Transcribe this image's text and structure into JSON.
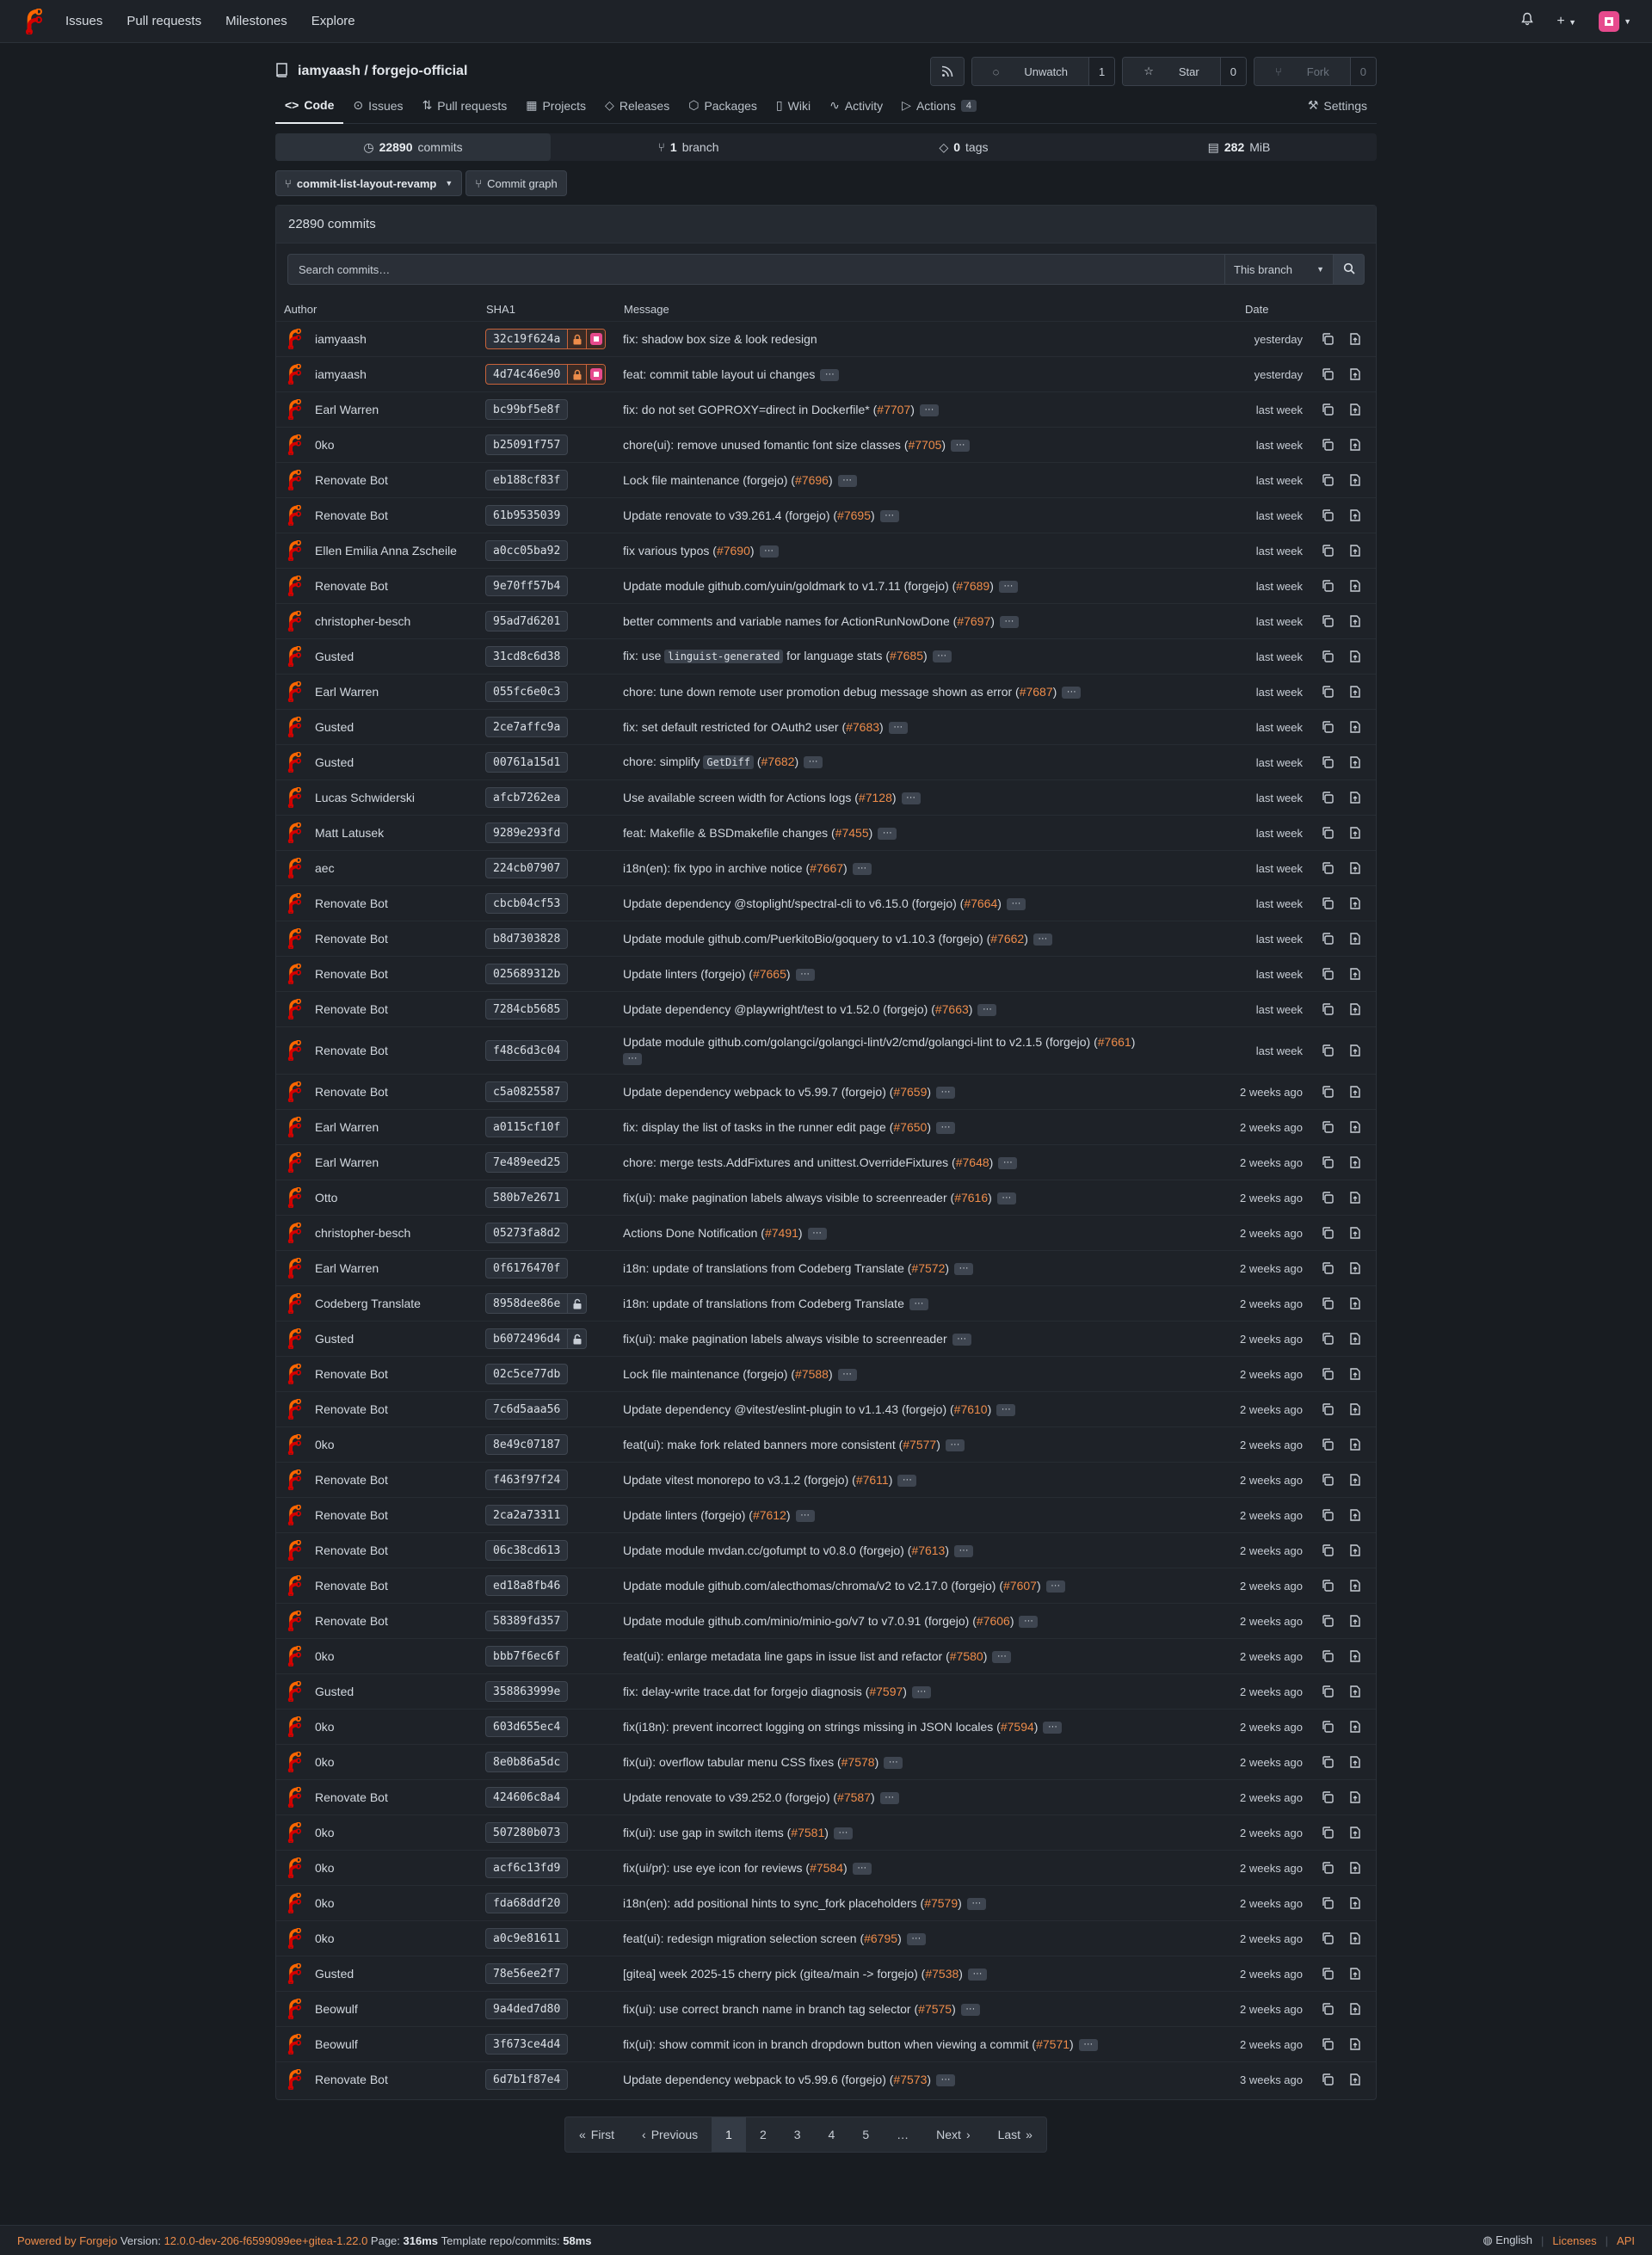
{
  "colors": {
    "accent": "#ee8c4a",
    "background": "#181c21",
    "surface": "#1e2228",
    "signed_border": "#c8633a"
  },
  "nav": {
    "links": [
      "Issues",
      "Pull requests",
      "Milestones",
      "Explore"
    ]
  },
  "repo": {
    "title": "iamyaash / forgejo-official",
    "unwatch_label": "Unwatch",
    "watch_count": "1",
    "star_label": "Star",
    "star_count": "0",
    "fork_label": "Fork",
    "fork_count": "0"
  },
  "tabs": [
    {
      "label": "Code",
      "icon": "code-icon"
    },
    {
      "label": "Issues",
      "icon": "issue-icon"
    },
    {
      "label": "Pull requests",
      "icon": "pull-request-icon"
    },
    {
      "label": "Projects",
      "icon": "project-icon"
    },
    {
      "label": "Releases",
      "icon": "tag-icon"
    },
    {
      "label": "Packages",
      "icon": "package-icon"
    },
    {
      "label": "Wiki",
      "icon": "book-icon"
    },
    {
      "label": "Activity",
      "icon": "pulse-icon"
    },
    {
      "label": "Actions",
      "icon": "play-icon",
      "badge": "4"
    },
    {
      "label": "Settings",
      "icon": "tool-icon"
    }
  ],
  "stats": {
    "commits_num": "22890",
    "commits_label": "commits",
    "branches_num": "1",
    "branches_label": "branch",
    "tags_num": "0",
    "tags_label": "tags",
    "size_num": "282",
    "size_unit": "MiB"
  },
  "branch": {
    "name": "commit-list-layout-revamp",
    "graph_label": "Commit graph"
  },
  "panel": {
    "title": "22890 commits",
    "search_placeholder": "Search commits…",
    "branch_filter": "This branch",
    "columns": {
      "author": "Author",
      "sha": "SHA1",
      "message": "Message",
      "date": "Date"
    }
  },
  "commits": [
    {
      "author": "iamyaash",
      "sha": "32c19f624a",
      "msg": "fix: shadow box size & look redesign",
      "pr": "",
      "date": "yesterday",
      "signed": true,
      "ell": false
    },
    {
      "author": "iamyaash",
      "sha": "4d74c46e90",
      "msg": "feat: commit table layout ui changes",
      "pr": "",
      "date": "yesterday",
      "signed": true,
      "ell": true
    },
    {
      "author": "Earl Warren",
      "sha": "bc99bf5e8f",
      "msg": "fix: do not set GOPROXY=direct in Dockerfile* (",
      "pr": "#7707",
      "date": "last week",
      "ell": true
    },
    {
      "author": "0ko",
      "sha": "b25091f757",
      "msg": "chore(ui): remove unused fomantic font size classes (",
      "pr": "#7705",
      "date": "last week",
      "ell": true
    },
    {
      "author": "Renovate Bot",
      "sha": "eb188cf83f",
      "msg": "Lock file maintenance (forgejo) (",
      "pr": "#7696",
      "date": "last week",
      "ell": true
    },
    {
      "author": "Renovate Bot",
      "sha": "61b9535039",
      "msg": "Update renovate to v39.261.4 (forgejo) (",
      "pr": "#7695",
      "date": "last week",
      "ell": true
    },
    {
      "author": "Ellen Emilia Anna Zscheile",
      "sha": "a0cc05ba92",
      "msg": "fix various typos (",
      "pr": "#7690",
      "date": "last week",
      "ell": true
    },
    {
      "author": "Renovate Bot",
      "sha": "9e70ff57b4",
      "msg": "Update module github.com/yuin/goldmark to v1.7.11 (forgejo) (",
      "pr": "#7689",
      "date": "last week",
      "ell": true
    },
    {
      "author": "christopher-besch",
      "sha": "95ad7d6201",
      "msg": "better comments and variable names for ActionRunNowDone (",
      "pr": "#7697",
      "date": "last week",
      "ell": true
    },
    {
      "author": "Gusted",
      "sha": "31cd8c6d38",
      "msg": "fix: use ",
      "code": "linguist-generated",
      "msg2": " for language stats (",
      "pr": "#7685",
      "date": "last week",
      "ell": true
    },
    {
      "author": "Earl Warren",
      "sha": "055fc6e0c3",
      "msg": "chore: tune down remote user promotion debug message shown as error (",
      "pr": "#7687",
      "date": "last week",
      "ell": true
    },
    {
      "author": "Gusted",
      "sha": "2ce7affc9a",
      "msg": "fix: set default restricted for OAuth2 user (",
      "pr": "#7683",
      "date": "last week",
      "ell": true
    },
    {
      "author": "Gusted",
      "sha": "00761a15d1",
      "msg": "chore: simplify ",
      "code": "GetDiff",
      "msg2": " (",
      "pr": "#7682",
      "date": "last week",
      "ell": true
    },
    {
      "author": "Lucas Schwiderski",
      "sha": "afcb7262ea",
      "msg": "Use available screen width for Actions logs (",
      "pr": "#7128",
      "date": "last week",
      "ell": true
    },
    {
      "author": "Matt Latusek",
      "sha": "9289e293fd",
      "msg": "feat: Makefile & BSDmakefile changes (",
      "pr": "#7455",
      "date": "last week",
      "ell": true
    },
    {
      "author": "aec",
      "sha": "224cb07907",
      "msg": "i18n(en): fix typo in archive notice (",
      "pr": "#7667",
      "date": "last week",
      "ell": true
    },
    {
      "author": "Renovate Bot",
      "sha": "cbcb04cf53",
      "msg": "Update dependency @stoplight/spectral-cli to v6.15.0 (forgejo) (",
      "pr": "#7664",
      "date": "last week",
      "ell": true
    },
    {
      "author": "Renovate Bot",
      "sha": "b8d7303828",
      "msg": "Update module github.com/PuerkitoBio/goquery to v1.10.3 (forgejo) (",
      "pr": "#7662",
      "date": "last week",
      "ell": true
    },
    {
      "author": "Renovate Bot",
      "sha": "025689312b",
      "msg": "Update linters (forgejo) (",
      "pr": "#7665",
      "date": "last week",
      "ell": true
    },
    {
      "author": "Renovate Bot",
      "sha": "7284cb5685",
      "msg": "Update dependency @playwright/test to v1.52.0 (forgejo) (",
      "pr": "#7663",
      "date": "last week",
      "ell": true
    },
    {
      "author": "Renovate Bot",
      "sha": "f48c6d3c04",
      "msg": "Update module github.com/golangci/golangci-lint/v2/cmd/golangci-lint to v2.1.5 (forgejo) (",
      "pr": "#7661",
      "date": "last week",
      "ell": true,
      "tall": true
    },
    {
      "author": "Renovate Bot",
      "sha": "c5a0825587",
      "msg": "Update dependency webpack to v5.99.7 (forgejo) (",
      "pr": "#7659",
      "date": "2 weeks ago",
      "ell": true
    },
    {
      "author": "Earl Warren",
      "sha": "a0115cf10f",
      "msg": "fix: display the list of tasks in the runner edit page (",
      "pr": "#7650",
      "date": "2 weeks ago",
      "ell": true
    },
    {
      "author": "Earl Warren",
      "sha": "7e489eed25",
      "msg": "chore: merge tests.AddFixtures and unittest.OverrideFixtures (",
      "pr": "#7648",
      "date": "2 weeks ago",
      "ell": true
    },
    {
      "author": "Otto",
      "sha": "580b7e2671",
      "msg": "fix(ui): make pagination labels always visible to screenreader (",
      "pr": "#7616",
      "date": "2 weeks ago",
      "ell": true
    },
    {
      "author": "christopher-besch",
      "sha": "05273fa8d2",
      "msg": "Actions Done Notification (",
      "pr": "#7491",
      "date": "2 weeks ago",
      "ell": true
    },
    {
      "author": "Earl Warren",
      "sha": "0f6176470f",
      "msg": "i18n: update of translations from Codeberg Translate (",
      "pr": "#7572",
      "date": "2 weeks ago",
      "ell": true
    },
    {
      "author": "Codeberg Translate",
      "sha": "8958dee86e",
      "msg": "i18n: update of translations from Codeberg Translate",
      "pr": "",
      "date": "2 weeks ago",
      "ell": true,
      "lock": true
    },
    {
      "author": "Gusted",
      "sha": "b6072496d4",
      "msg": "fix(ui): make pagination labels always visible to screenreader",
      "pr": "",
      "date": "2 weeks ago",
      "ell": true,
      "lock": true
    },
    {
      "author": "Renovate Bot",
      "sha": "02c5ce77db",
      "msg": "Lock file maintenance (forgejo) (",
      "pr": "#7588",
      "date": "2 weeks ago",
      "ell": true
    },
    {
      "author": "Renovate Bot",
      "sha": "7c6d5aaa56",
      "msg": "Update dependency @vitest/eslint-plugin to v1.1.43 (forgejo) (",
      "pr": "#7610",
      "date": "2 weeks ago",
      "ell": true
    },
    {
      "author": "0ko",
      "sha": "8e49c07187",
      "msg": "feat(ui): make fork related banners more consistent (",
      "pr": "#7577",
      "date": "2 weeks ago",
      "ell": true
    },
    {
      "author": "Renovate Bot",
      "sha": "f463f97f24",
      "msg": "Update vitest monorepo to v3.1.2 (forgejo) (",
      "pr": "#7611",
      "date": "2 weeks ago",
      "ell": true
    },
    {
      "author": "Renovate Bot",
      "sha": "2ca2a73311",
      "msg": "Update linters (forgejo) (",
      "pr": "#7612",
      "date": "2 weeks ago",
      "ell": true
    },
    {
      "author": "Renovate Bot",
      "sha": "06c38cd613",
      "msg": "Update module mvdan.cc/gofumpt to v0.8.0 (forgejo) (",
      "pr": "#7613",
      "date": "2 weeks ago",
      "ell": true
    },
    {
      "author": "Renovate Bot",
      "sha": "ed18a8fb46",
      "msg": "Update module github.com/alecthomas/chroma/v2 to v2.17.0 (forgejo) (",
      "pr": "#7607",
      "date": "2 weeks ago",
      "ell": true
    },
    {
      "author": "Renovate Bot",
      "sha": "58389fd357",
      "msg": "Update module github.com/minio/minio-go/v7 to v7.0.91 (forgejo) (",
      "pr": "#7606",
      "date": "2 weeks ago",
      "ell": true
    },
    {
      "author": "0ko",
      "sha": "bbb7f6ec6f",
      "msg": "feat(ui): enlarge metadata line gaps in issue list and refactor (",
      "pr": "#7580",
      "date": "2 weeks ago",
      "ell": true
    },
    {
      "author": "Gusted",
      "sha": "358863999e",
      "msg": "fix: delay-write trace.dat for forgejo diagnosis (",
      "pr": "#7597",
      "date": "2 weeks ago",
      "ell": true
    },
    {
      "author": "0ko",
      "sha": "603d655ec4",
      "msg": "fix(i18n): prevent incorrect logging on strings missing in JSON locales (",
      "pr": "#7594",
      "date": "2 weeks ago",
      "ell": true
    },
    {
      "author": "0ko",
      "sha": "8e0b86a5dc",
      "msg": "fix(ui): overflow tabular menu CSS fixes (",
      "pr": "#7578",
      "date": "2 weeks ago",
      "ell": true
    },
    {
      "author": "Renovate Bot",
      "sha": "424606c8a4",
      "msg": "Update renovate to v39.252.0 (forgejo) (",
      "pr": "#7587",
      "date": "2 weeks ago",
      "ell": true
    },
    {
      "author": "0ko",
      "sha": "507280b073",
      "msg": "fix(ui): use gap in switch items (",
      "pr": "#7581",
      "date": "2 weeks ago",
      "ell": true
    },
    {
      "author": "0ko",
      "sha": "acf6c13fd9",
      "msg": "fix(ui/pr): use eye icon for reviews (",
      "pr": "#7584",
      "date": "2 weeks ago",
      "ell": true
    },
    {
      "author": "0ko",
      "sha": "fda68ddf20",
      "msg": "i18n(en): add positional hints to sync_fork placeholders (",
      "pr": "#7579",
      "date": "2 weeks ago",
      "ell": true
    },
    {
      "author": "0ko",
      "sha": "a0c9e81611",
      "msg": "feat(ui): redesign migration selection screen (",
      "pr": "#6795",
      "date": "2 weeks ago",
      "ell": true
    },
    {
      "author": "Gusted",
      "sha": "78e56ee2f7",
      "msg": "[gitea] week 2025-15 cherry pick (gitea/main -> forgejo) (",
      "pr": "#7538",
      "date": "2 weeks ago",
      "ell": true
    },
    {
      "author": "Beowulf",
      "sha": "9a4ded7d80",
      "msg": "fix(ui): use correct branch name in branch tag selector (",
      "pr": "#7575",
      "date": "2 weeks ago",
      "ell": true
    },
    {
      "author": "Beowulf",
      "sha": "3f673ce4d4",
      "msg": "fix(ui): show commit icon in branch dropdown button when viewing a commit (",
      "pr": "#7571",
      "date": "2 weeks ago",
      "ell": true
    },
    {
      "author": "Renovate Bot",
      "sha": "6d7b1f87e4",
      "msg": "Update dependency webpack to v5.99.6 (forgejo) (",
      "pr": "#7573",
      "date": "3 weeks ago",
      "ell": true
    }
  ],
  "pagination": {
    "first": "First",
    "previous": "Previous",
    "pages": [
      "1",
      "2",
      "3",
      "4",
      "5"
    ],
    "gap": "…",
    "next": "Next",
    "last": "Last",
    "current": "1"
  },
  "footer": {
    "powered": "Powered by Forgejo",
    "version_label": "Version:",
    "version": "12.0.0-dev-206-f6599099ee+gitea-1.22.0",
    "page_label": "Page:",
    "page_time": "316ms",
    "template_label": "Template",
    "template_name": "repo/commits:",
    "template_time": "58ms",
    "language": "English",
    "licenses": "Licenses",
    "api": "API"
  }
}
